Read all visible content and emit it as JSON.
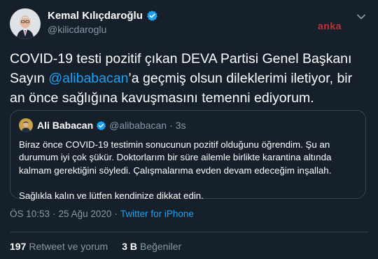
{
  "author": {
    "name": "Kemal Kılıçdaroğlu",
    "handle": "@kilicdaroglu"
  },
  "watermark": "anka",
  "tweet": {
    "text_before": "COVID-19 testi pozitif çıkan DEVA Partisi Genel Başkanı Sayın ",
    "mention": "@alibabacan",
    "text_after": "’a geçmiş olsun dileklerimi iletiyor, bir an önce sağlığına kavuşmasını temenni ediyorum."
  },
  "quoted": {
    "name": "Ali Babacan",
    "handle": "@alibabacan",
    "dot": "·",
    "time": "3s",
    "paragraph1": "Biraz önce COVID-19 testimin sonucunun pozitif olduğunu öğrendim. Şu an durumum iyi çok şükür. Doktorlarım bir süre ailemle birlikte karantina altında kalmam gerektiğini söyledi. Çalışmalarıma evden devam edeceğim inşallah.",
    "paragraph2": "Sağlıkla kalın ve lütfen kendinize dikkat edin."
  },
  "meta": {
    "time": "ÖS 10:53",
    "separator": "·",
    "date": "25 Ağu 2020",
    "source": "Twitter for iPhone"
  },
  "stats": {
    "retweets_count": "197",
    "retweets_label": "Retweet ve yorum",
    "likes_count": "3 B",
    "likes_label": "Beğeniler"
  },
  "colors": {
    "background": "#15202b",
    "accent": "#1da1f2",
    "secondary_text": "#8899a6",
    "border": "#38444d",
    "watermark": "#c0303a"
  },
  "icons": [
    "verified-badge-icon",
    "chevron-down-icon"
  ]
}
